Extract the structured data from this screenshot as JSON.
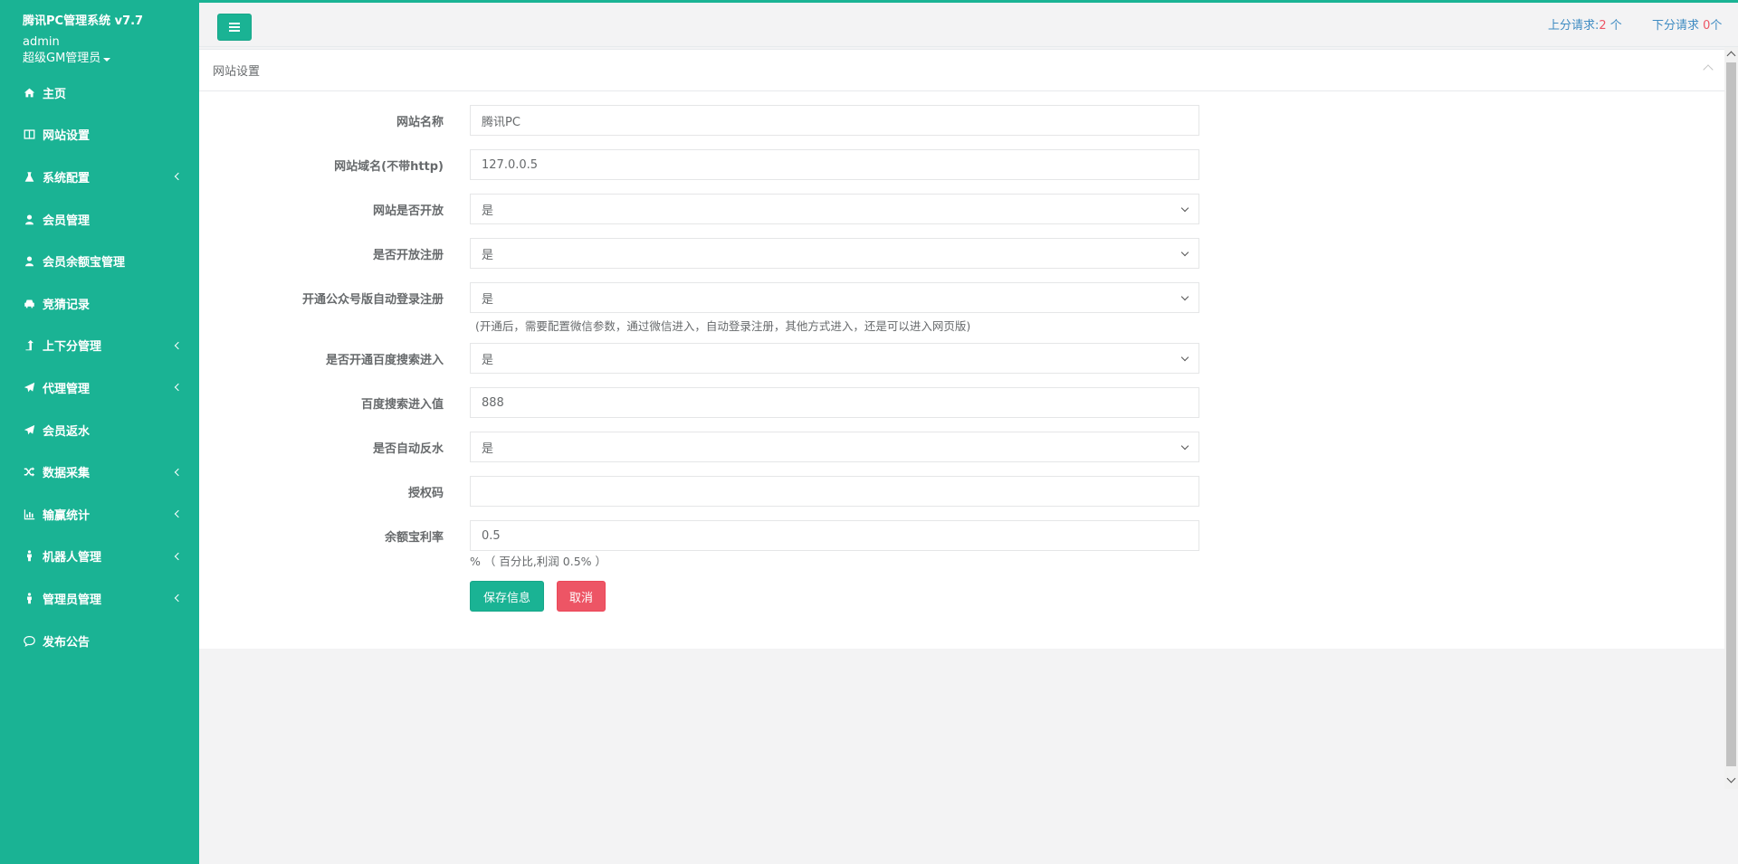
{
  "sidebar": {
    "app_title": "腾讯PC管理系统 v7.7",
    "user": "admin",
    "role": "超级GM管理员",
    "items": [
      {
        "label": "主页",
        "icon": "home-icon",
        "submenu": false
      },
      {
        "label": "网站设置",
        "icon": "columns-icon",
        "submenu": false
      },
      {
        "label": "系统配置",
        "icon": "flask-icon",
        "submenu": true
      },
      {
        "label": "会员管理",
        "icon": "user-icon",
        "submenu": false
      },
      {
        "label": "会员余额宝管理",
        "icon": "user-icon",
        "submenu": false
      },
      {
        "label": "竞猜记录",
        "icon": "car-icon",
        "submenu": false
      },
      {
        "label": "上下分管理",
        "icon": "level-up-icon",
        "submenu": true
      },
      {
        "label": "代理管理",
        "icon": "paper-plane-icon",
        "submenu": true
      },
      {
        "label": "会员返水",
        "icon": "paper-plane-icon",
        "submenu": false
      },
      {
        "label": "数据采集",
        "icon": "random-icon",
        "submenu": true
      },
      {
        "label": "输赢统计",
        "icon": "bar-chart-icon",
        "submenu": true
      },
      {
        "label": "机器人管理",
        "icon": "male-icon",
        "submenu": true
      },
      {
        "label": "管理员管理",
        "icon": "male-icon",
        "submenu": true
      },
      {
        "label": "发布公告",
        "icon": "comment-icon",
        "submenu": false
      }
    ]
  },
  "topbar": {
    "up_label": "上分请求:",
    "up_count": "2",
    "up_unit": " 个",
    "down_label": "下分请求 ",
    "down_count": "0",
    "down_unit": "个"
  },
  "panel": {
    "title": "网站设置",
    "fields": [
      {
        "label": "网站名称",
        "value": "腾讯PC",
        "type": "input"
      },
      {
        "label": "网站域名(不带http)",
        "value": "127.0.0.5",
        "type": "input"
      },
      {
        "label": "网站是否开放",
        "value": "是",
        "type": "select"
      },
      {
        "label": "是否开放注册",
        "value": "是",
        "type": "select"
      },
      {
        "label": "开通公众号版自动登录注册",
        "value": "是",
        "type": "select",
        "help": "(开通后，需要配置微信参数，通过微信进入，自动登录注册，其他方式进入，还是可以进入网页版)"
      },
      {
        "label": "是否开通百度搜索进入",
        "value": "是",
        "type": "select"
      },
      {
        "label": "百度搜索进入值",
        "value": "888",
        "type": "input"
      },
      {
        "label": "是否自动反水",
        "value": "是",
        "type": "select"
      },
      {
        "label": "授权码",
        "value": "",
        "type": "input"
      },
      {
        "label": "余额宝利率",
        "value": "0.5",
        "type": "input",
        "help": "% （ 百分比,利润 0.5% ）"
      }
    ],
    "save_label": "保存信息",
    "cancel_label": "取消"
  },
  "colors": {
    "accent": "#1ab394",
    "danger": "#ed5565",
    "link": "#3e8bc2"
  }
}
